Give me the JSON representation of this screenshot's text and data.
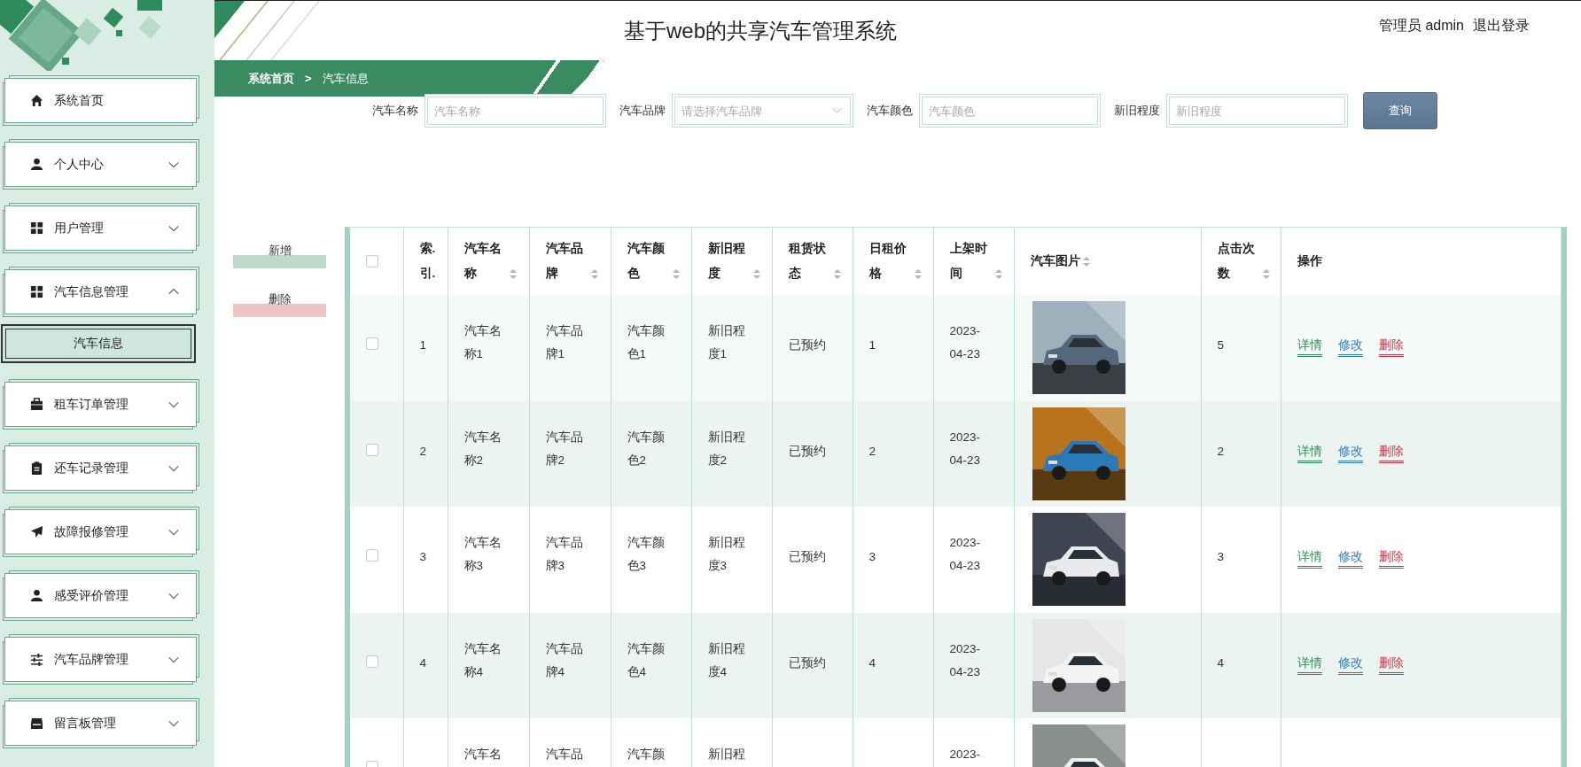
{
  "sidebar": {
    "items": [
      {
        "label": "系统首页"
      },
      {
        "label": "个人中心",
        "expanded": false
      },
      {
        "label": "用户管理",
        "expanded": false
      },
      {
        "label": "汽车信息管理",
        "expanded": true,
        "children": [
          {
            "label": "汽车信息",
            "selected": true
          }
        ]
      },
      {
        "label": "租车订单管理",
        "expanded": false
      },
      {
        "label": "还车记录管理",
        "expanded": false
      },
      {
        "label": "故障报修管理",
        "expanded": false
      },
      {
        "label": "感受评价管理",
        "expanded": false
      },
      {
        "label": "汽车品牌管理",
        "expanded": false
      },
      {
        "label": "留言板管理",
        "expanded": false
      }
    ]
  },
  "header": {
    "title": "基于web的共享汽车管理系统",
    "user": "管理员 admin",
    "logout": "退出登录"
  },
  "breadcrumb": {
    "items": [
      "系统首页",
      "汽车信息"
    ],
    "separator": ">"
  },
  "search": {
    "fields": [
      {
        "label": "汽车名称",
        "placeholder": "汽车名称",
        "kind": "input"
      },
      {
        "label": "汽车品牌",
        "placeholder": "请选择汽车品牌",
        "kind": "select"
      },
      {
        "label": "汽车颜色",
        "placeholder": "汽车颜色",
        "kind": "input"
      },
      {
        "label": "新旧程度",
        "placeholder": "新旧程度",
        "kind": "input"
      }
    ],
    "button": "查询"
  },
  "actions": [
    {
      "label": "新增",
      "kind": "add"
    },
    {
      "label": "删除",
      "kind": "delete"
    }
  ],
  "table": {
    "columns": [
      {
        "kind": "checkbox",
        "selected": false
      },
      {
        "label": "索.引.",
        "sortable": false
      },
      {
        "label": "汽车名称",
        "sortable": true
      },
      {
        "label": "汽车品牌",
        "sortable": true
      },
      {
        "label": "汽车颜色",
        "sortable": true
      },
      {
        "label": "新旧程度",
        "sortable": true
      },
      {
        "label": "租赁状态",
        "sortable": true
      },
      {
        "label": "日租价格",
        "sortable": true
      },
      {
        "label": "上架时间",
        "sortable": true
      },
      {
        "label": "汽车图片",
        "sortable": true
      },
      {
        "label": "点击次数",
        "sortable": true
      },
      {
        "label": "操作",
        "sortable": false
      }
    ],
    "rows": [
      {
        "selected": false,
        "index": "1",
        "name": "汽车名称1",
        "brand": "汽车品牌1",
        "car_color": "汽车颜色1",
        "condition": "新旧程度1",
        "status": "已预约",
        "price": "1",
        "listed": "2023-04-23",
        "image": {
          "kind": "picture"
        },
        "clicks": "5",
        "actions": [
          {
            "label": "详情",
            "kind": "detail"
          },
          {
            "label": "修改",
            "kind": "edit"
          },
          {
            "label": "删除",
            "kind": "delete"
          }
        ]
      },
      {
        "selected": false,
        "index": "2",
        "name": "汽车名称2",
        "brand": "汽车品牌2",
        "car_color": "汽车颜色2",
        "condition": "新旧程度2",
        "status": "已预约",
        "price": "2",
        "listed": "2023-04-23",
        "image": {
          "kind": "picture"
        },
        "clicks": "2",
        "actions": [
          {
            "label": "详情",
            "kind": "detail"
          },
          {
            "label": "修改",
            "kind": "edit"
          },
          {
            "label": "删除",
            "kind": "delete"
          }
        ]
      },
      {
        "selected": false,
        "index": "3",
        "name": "汽车名称3",
        "brand": "汽车品牌3",
        "car_color": "汽车颜色3",
        "condition": "新旧程度3",
        "status": "已预约",
        "price": "3",
        "listed": "2023-04-23",
        "image": {
          "kind": "picture"
        },
        "clicks": "3",
        "actions": [
          {
            "label": "详情",
            "kind": "detail"
          },
          {
            "label": "修改",
            "kind": "edit"
          },
          {
            "label": "删除",
            "kind": "delete"
          }
        ]
      },
      {
        "selected": false,
        "index": "4",
        "name": "汽车名称4",
        "brand": "汽车品牌4",
        "car_color": "汽车颜色4",
        "condition": "新旧程度4",
        "status": "已预约",
        "price": "4",
        "listed": "2023-04-23",
        "image": {
          "kind": "picture"
        },
        "clicks": "4",
        "actions": [
          {
            "label": "详情",
            "kind": "detail"
          },
          {
            "label": "修改",
            "kind": "edit"
          },
          {
            "label": "删除",
            "kind": "delete"
          }
        ]
      },
      {
        "selected": false,
        "name": "汽车名",
        "brand": "汽车品",
        "car_color": "汽车颜",
        "condition": "新旧程",
        "listed": "2023-",
        "image": {
          "kind": "picture"
        }
      }
    ]
  }
}
